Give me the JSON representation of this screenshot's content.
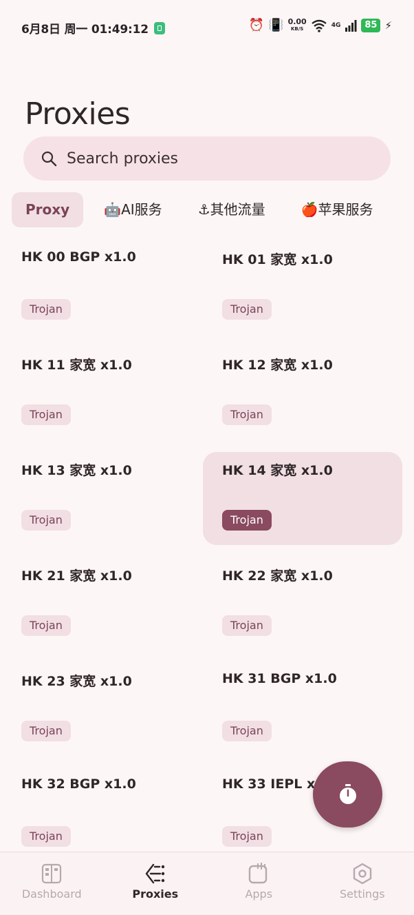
{
  "status_bar": {
    "time": "6月8日 周一 01:49:12",
    "net_speed": "0.00",
    "net_unit": "KB/S",
    "signal": "4G",
    "battery": "85"
  },
  "page": {
    "title": "Proxies"
  },
  "search": {
    "placeholder": "Search proxies"
  },
  "tabs": [
    {
      "label": "Proxy",
      "active": true
    },
    {
      "label": "🤖AI服务",
      "active": false
    },
    {
      "label": "⚓其他流量",
      "active": false
    },
    {
      "label": "🍎苹果服务",
      "active": false
    }
  ],
  "proxies": [
    {
      "name": "HK 00 BGP x1.0",
      "type": "Trojan"
    },
    {
      "name": "HK 01 家宽 x1.0",
      "type": "Trojan"
    },
    {
      "name": "HK 11 家宽 x1.0",
      "type": "Trojan"
    },
    {
      "name": "HK 12 家宽 x1.0",
      "type": "Trojan"
    },
    {
      "name": "HK 13 家宽 x1.0",
      "type": "Trojan"
    },
    {
      "name": "HK 14 家宽 x1.0",
      "type": "Trojan",
      "selected": true
    },
    {
      "name": "HK 21 家宽 x1.0",
      "type": "Trojan"
    },
    {
      "name": "HK 22 家宽 x1.0",
      "type": "Trojan"
    },
    {
      "name": "HK 23 家宽 x1.0",
      "type": "Trojan"
    },
    {
      "name": "HK 31 BGP x1.0",
      "type": "Trojan"
    },
    {
      "name": "HK 32 BGP x1.0",
      "type": "Trojan"
    },
    {
      "name": "HK 33 IEPL x1.0",
      "type": "Trojan"
    }
  ],
  "fab": {
    "icon": "stopwatch-icon"
  },
  "bottom_nav": [
    {
      "label": "Dashboard",
      "icon": "dashboard-icon",
      "active": false
    },
    {
      "label": "Proxies",
      "icon": "proxies-icon",
      "active": true
    },
    {
      "label": "Apps",
      "icon": "apps-icon",
      "active": false
    },
    {
      "label": "Settings",
      "icon": "settings-icon",
      "active": false
    }
  ],
  "colors": {
    "accent": "#8a4a5f",
    "surface_tint": "#f1dfe4",
    "background": "#fdf6f6"
  }
}
